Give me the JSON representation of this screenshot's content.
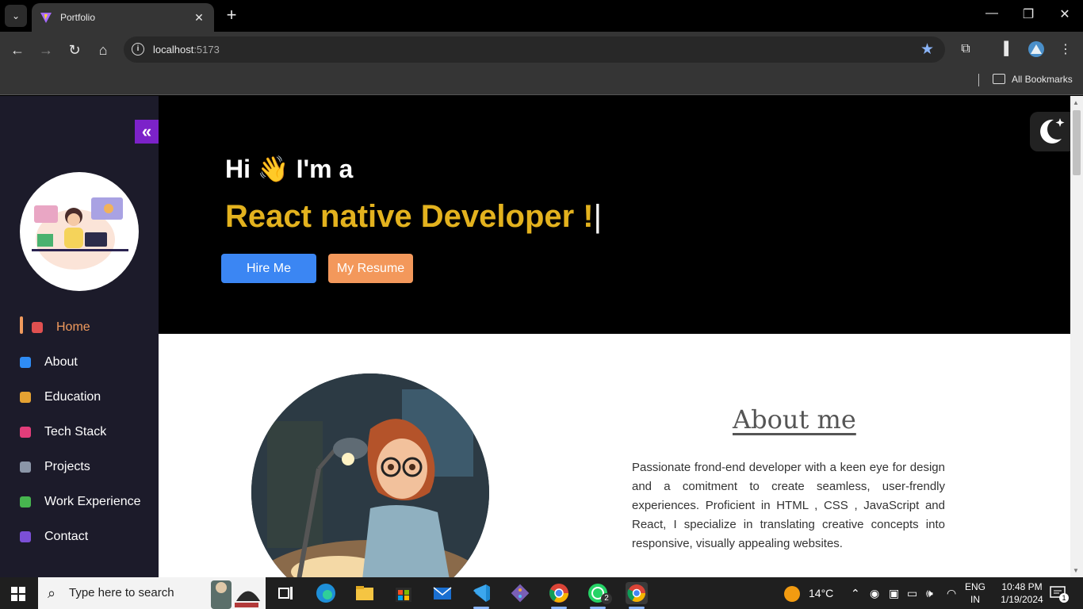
{
  "browser": {
    "tab_title": "Portfolio",
    "url_host": "localhost",
    "url_port": ":5173",
    "bookmarks_label": "All Bookmarks"
  },
  "sidebar": {
    "items": [
      {
        "label": "Home",
        "icon": "home-icon",
        "color": "#f09a5d"
      },
      {
        "label": "About",
        "icon": "info-icon",
        "color": "#2f8cf5"
      },
      {
        "label": "Education",
        "icon": "student-icon",
        "color": "#e5a232"
      },
      {
        "label": "Tech Stack",
        "icon": "hourglass-icon",
        "color": "#e23d7a"
      },
      {
        "label": "Projects",
        "icon": "gamepad-icon",
        "color": "#8b96a8"
      },
      {
        "label": "Work Experience",
        "icon": "worker-icon",
        "color": "#47b54f"
      },
      {
        "label": "Contact",
        "icon": "contact-icon",
        "color": "#7b4fd6"
      }
    ]
  },
  "hero": {
    "greeting": "Hi 👋 I'm a",
    "role": "React native Developer !",
    "caret": "|",
    "hire_label": "Hire Me",
    "resume_label": "My Resume"
  },
  "about": {
    "title": "About me",
    "text": "Passionate frond-end developer with a keen eye for design and a comitment to create seamless, user-frendly experiences. Proficient in HTML , CSS , JavaScript and React, I specialize in translating creative concepts into responsive, visually appealing websites."
  },
  "taskbar": {
    "search_placeholder": "Type here to search",
    "weather": "14°C",
    "lang_1": "ENG",
    "lang_2": "IN",
    "time": "10:48 PM",
    "date": "1/19/2024",
    "whatsapp_badge": "2",
    "notif_count": "1"
  },
  "colors": {
    "accent_purple": "#7c22c9",
    "hire_blue": "#3b86f3",
    "resume_orange": "#f3985b",
    "role_gold": "#e3b21e"
  }
}
